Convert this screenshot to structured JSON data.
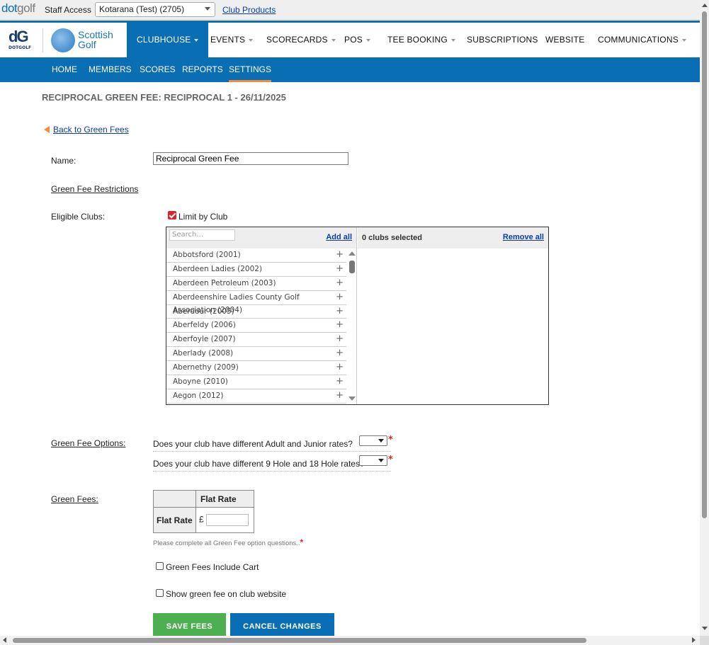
{
  "staffbar": {
    "logo_dot": "dot",
    "logo_golf": "golf",
    "label": "Staff Access",
    "club_selected": "Kotarana (Test) (2705)",
    "club_products_link": "Club Products"
  },
  "brand": {
    "dg_mark": "dG",
    "dg_sub": "DOTGOLF",
    "sg_line1": "Scottish",
    "sg_line2": "Golf"
  },
  "nav": {
    "items": [
      {
        "label": "CLUBHOUSE",
        "has_menu": true,
        "active": true
      },
      {
        "label": "EVENTS",
        "has_menu": true
      },
      {
        "label": "SCORECARDS",
        "has_menu": true
      },
      {
        "label": "POS",
        "has_menu": true
      },
      {
        "label": "TEE BOOKING",
        "has_menu": true
      },
      {
        "label": "SUBSCRIPTIONS",
        "has_menu": false
      },
      {
        "label": "WEBSITE",
        "has_menu": false
      },
      {
        "label": "COMMUNICATIONS",
        "has_menu": true
      }
    ]
  },
  "subnav": {
    "items": [
      {
        "label": "HOME"
      },
      {
        "label": "MEMBERS"
      },
      {
        "label": "SCORES"
      },
      {
        "label": "REPORTS"
      },
      {
        "label": "SETTINGS",
        "active": true
      }
    ]
  },
  "page": {
    "title": "RECIPROCAL GREEN FEE: RECIPROCAL 1 - 26/11/2025",
    "back_link": "Back to Green Fees"
  },
  "form": {
    "name_label": "Name:",
    "name_value": "Reciprocal Green Fee",
    "restrictions_heading": "Green Fee Restrictions",
    "eligible_label": "Eligible Clubs:",
    "limit_by_club_label": "Limit by Club",
    "limit_by_club_checked": true,
    "picker": {
      "search_placeholder": "Search...",
      "add_all": "Add all",
      "selected_count": "0 clubs selected",
      "remove_all": "Remove all",
      "clubs": [
        "Abbotsford (2001)",
        "Aberdeen Ladies (2002)",
        "Aberdeen Petroleum (2003)",
        "Aberdeenshire Ladies County Golf Association (2004)",
        "Aberdour (2005)",
        "Aberfeldy (2006)",
        "Aberfoyle (2007)",
        "Aberlady (2008)",
        "Abernethy (2009)",
        "Aboyne (2010)",
        "Aegon (2012)"
      ]
    },
    "options_label": "Green Fee Options:",
    "options": [
      {
        "question": "Does your club have different Adult and Junior rates?",
        "value": ""
      },
      {
        "question": "Does your club have different 9 Hole and 18 Hole rates?",
        "value": ""
      }
    ],
    "required_mark": "*",
    "fees_label": "Green Fees:",
    "fee_table": {
      "column_header": "Flat Rate",
      "row_header": "Flat Rate",
      "currency": "£",
      "value": ""
    },
    "fee_note": "Please complete all Green Fee option questions..",
    "include_cart_label": "Green Fees Include Cart",
    "show_on_website_label": "Show green fee on club website",
    "save_button": "SAVE FEES",
    "cancel_button": "CANCEL CHANGES"
  },
  "colors": {
    "primary": "#0a6eb4",
    "accent": "#f08c3c",
    "save": "#4caf50",
    "required": "#d9262c"
  }
}
